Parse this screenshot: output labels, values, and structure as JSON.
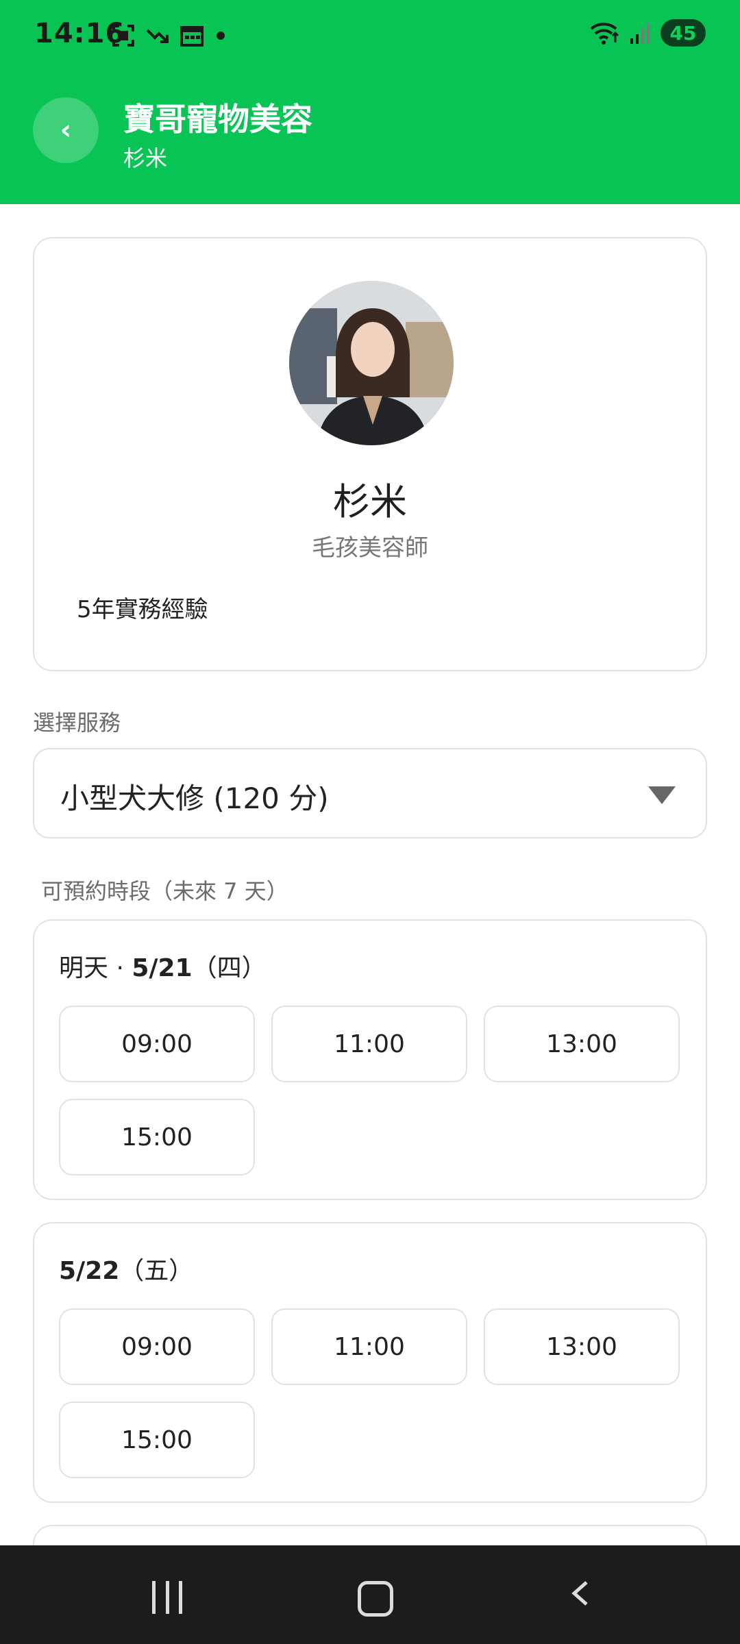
{
  "status_bar": {
    "time": "14:16",
    "battery": "45"
  },
  "header": {
    "title": "寶哥寵物美容",
    "subtitle": "杉米",
    "back_glyph": "‹"
  },
  "profile": {
    "name": "杉米",
    "role": "毛孩美容師",
    "experience": "5年實務經驗"
  },
  "service": {
    "label": "選擇服務",
    "selected": "小型犬大修 (120 分)"
  },
  "availability": {
    "label": "可預約時段（未來 7 天）",
    "days": [
      {
        "prefix": "明天 · ",
        "date": "5/21",
        "weekday": "（四）",
        "slots": [
          "09:00",
          "11:00",
          "13:00",
          "15:00"
        ]
      },
      {
        "prefix": "",
        "date": "5/22",
        "weekday": "（五）",
        "slots": [
          "09:00",
          "11:00",
          "13:00",
          "15:00"
        ]
      }
    ]
  },
  "colors": {
    "brand_green": "#08c454",
    "nav_bar": "#1c1c1e"
  }
}
